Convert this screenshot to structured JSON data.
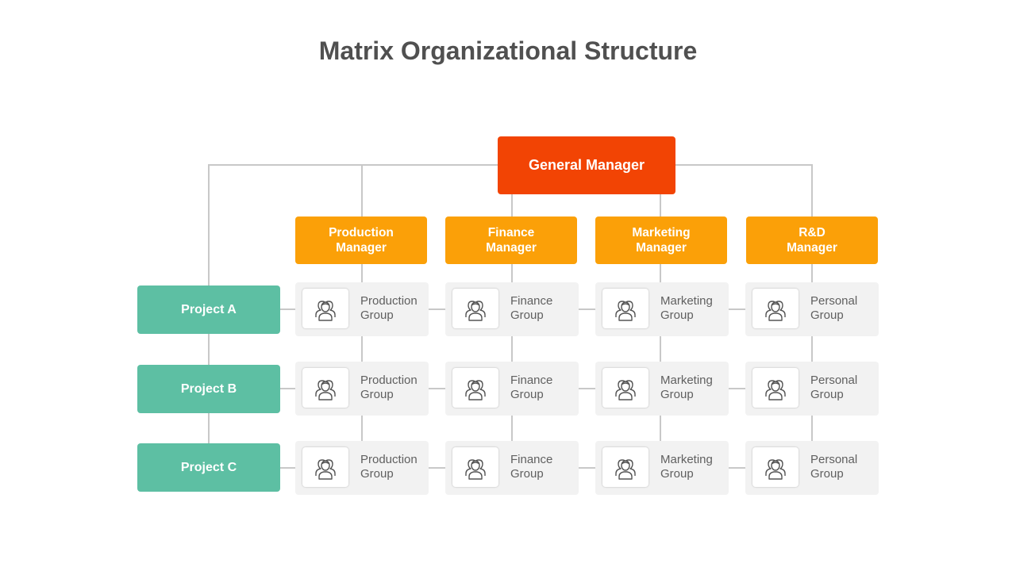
{
  "title": "Matrix Organizational Structure",
  "general_manager": "General Manager",
  "managers": [
    {
      "line1": "Production",
      "line2": "Manager"
    },
    {
      "line1": "Finance",
      "line2": "Manager"
    },
    {
      "line1": "Marketing",
      "line2": "Manager"
    },
    {
      "line1": "R&D",
      "line2": "Manager"
    }
  ],
  "projects": [
    "Project A",
    "Project B",
    "Project C"
  ],
  "groups": [
    {
      "line1": "Production",
      "line2": "Group"
    },
    {
      "line1": "Finance",
      "line2": "Group"
    },
    {
      "line1": "Marketing",
      "line2": "Group"
    },
    {
      "line1": "Personal",
      "line2": "Group"
    }
  ],
  "icon": "team-icon",
  "colors": {
    "general_manager": "#f24404",
    "manager": "#fba008",
    "project": "#5dbfa3",
    "group_bg": "#f2f2f2",
    "connector": "#c8c8c8",
    "title": "#505050"
  }
}
